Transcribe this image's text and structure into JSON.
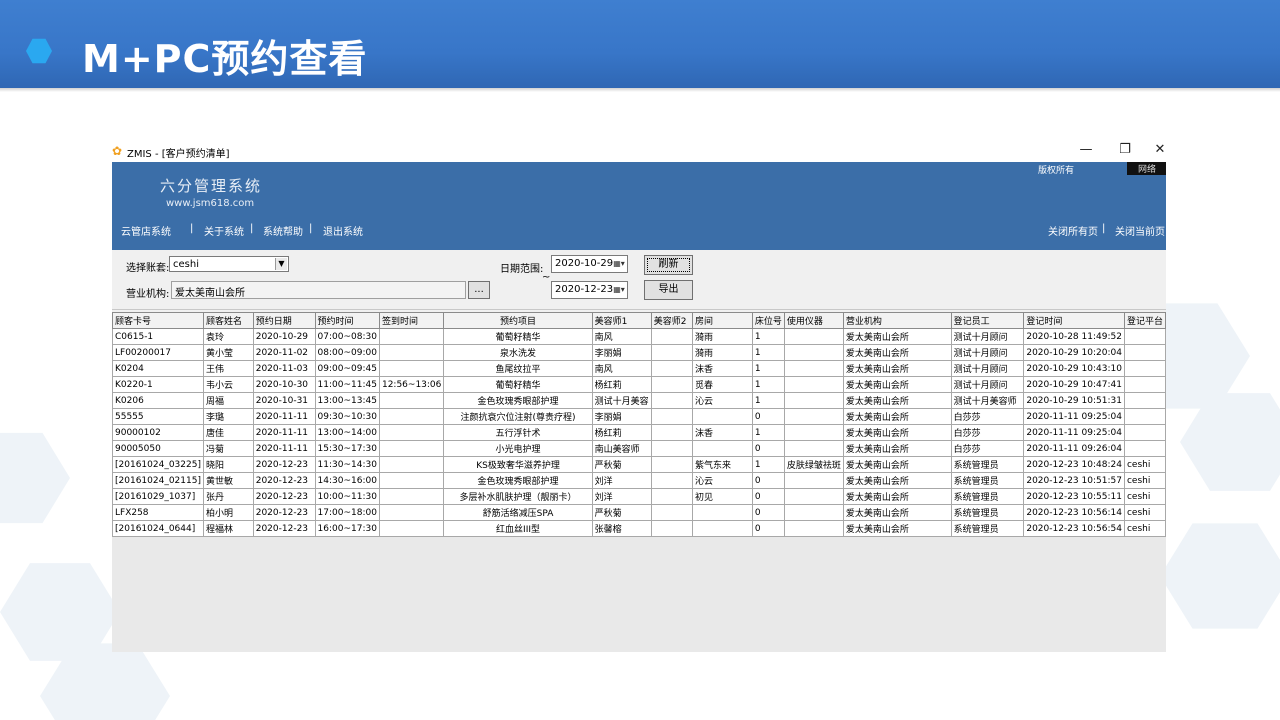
{
  "slide": {
    "title": "M+PC预约查看"
  },
  "window": {
    "title": "ZMIS - [客户预约清单]",
    "app_icon": "flower-icon",
    "minimize": "—",
    "restore": "❐",
    "close": "✕"
  },
  "banner": {
    "brand": "六分管理系统",
    "url": "www.jsm618.com",
    "copyright": "版权所有",
    "network": "网络",
    "menu": [
      "云管店系统",
      "关于系统",
      "系统帮助",
      "退出系统"
    ],
    "separator": "|",
    "right_menu": [
      "关闭所有页",
      "关闭当前页"
    ]
  },
  "filter": {
    "account_label": "选择账套:",
    "account_value": "ceshi",
    "org_label": "营业机构:",
    "org_value": "爱太美南山会所",
    "browse": "...",
    "date_label": "日期范围:",
    "date_tilde": "~",
    "date_from": "2020-10-29",
    "date_to": "2020-12-23",
    "refresh": "刷新",
    "export": "导出"
  },
  "table": {
    "columns": [
      "顾客卡号",
      "顾客姓名",
      "预约日期",
      "预约时间",
      "签到时间",
      "预约项目",
      "美容师1",
      "美容师2",
      "房间",
      "床位号",
      "使用仪器",
      "营业机构",
      "登记员工",
      "登记时间",
      "登记平台"
    ],
    "rows": [
      [
        "C0615-1",
        "袁玲",
        "2020-10-29",
        "07:00~08:30",
        "",
        "葡萄籽精华",
        "南风",
        "",
        "漪雨",
        "1",
        "",
        "爱太美南山会所",
        "测试十月顾问",
        "2020-10-28 11:49:52",
        ""
      ],
      [
        "LF00200017",
        "黄小莹",
        "2020-11-02",
        "08:00~09:00",
        "",
        "泉水洗发",
        "李丽娟",
        "",
        "漪雨",
        "1",
        "",
        "爱太美南山会所",
        "测试十月顾问",
        "2020-10-29 10:20:04",
        ""
      ],
      [
        "K0204",
        "王伟",
        "2020-11-03",
        "09:00~09:45",
        "",
        "鱼尾纹拉平",
        "南风",
        "",
        "沫香",
        "1",
        "",
        "爱太美南山会所",
        "测试十月顾问",
        "2020-10-29 10:43:10",
        ""
      ],
      [
        "K0220-1",
        "韦小云",
        "2020-10-30",
        "11:00~11:45",
        "12:56~13:06",
        "葡萄籽精华",
        "杨红莉",
        "",
        "觅春",
        "1",
        "",
        "爱太美南山会所",
        "测试十月顾问",
        "2020-10-29 10:47:41",
        ""
      ],
      [
        "K0206",
        "周福",
        "2020-10-31",
        "13:00~13:45",
        "",
        "金色玫瑰秀眼部护理",
        "测试十月美容",
        "",
        "沁云",
        "1",
        "",
        "爱太美南山会所",
        "测试十月美容师",
        "2020-10-29 10:51:31",
        ""
      ],
      [
        "55555",
        "李璐",
        "2020-11-11",
        "09:30~10:30",
        "",
        "注颜抗衰穴位注射(尊贵疗程)",
        "李丽娟",
        "",
        "",
        "0",
        "",
        "爱太美南山会所",
        "白莎莎",
        "2020-11-11 09:25:04",
        ""
      ],
      [
        "90000102",
        "唐佳",
        "2020-11-11",
        "13:00~14:00",
        "",
        "五行浮针术",
        "杨红莉",
        "",
        "沫香",
        "1",
        "",
        "爱太美南山会所",
        "白莎莎",
        "2020-11-11 09:25:04",
        ""
      ],
      [
        "90005050",
        "冯菊",
        "2020-11-11",
        "15:30~17:30",
        "",
        "小光电护理",
        "南山美容师",
        "",
        "",
        "0",
        "",
        "爱太美南山会所",
        "白莎莎",
        "2020-11-11 09:26:04",
        ""
      ],
      [
        "[20161024_03225]",
        "晓阳",
        "2020-12-23",
        "11:30~14:30",
        "",
        "KS极致奢华滋养护理",
        "严秋菊",
        "",
        "紫气东来",
        "1",
        "皮肤绿皱祛斑",
        "爱太美南山会所",
        "系统管理员",
        "2020-12-23 10:48:24",
        "ceshi"
      ],
      [
        "[20161024_02115]",
        "黄世敏",
        "2020-12-23",
        "14:30~16:00",
        "",
        "金色玫瑰秀眼部护理",
        "刘洋",
        "",
        "沁云",
        "0",
        "",
        "爱太美南山会所",
        "系统管理员",
        "2020-12-23 10:51:57",
        "ceshi"
      ],
      [
        "[20161029_1037]",
        "张丹",
        "2020-12-23",
        "10:00~11:30",
        "",
        "多层补水肌肤护理（靓丽卡）",
        "刘洋",
        "",
        "初见",
        "0",
        "",
        "爱太美南山会所",
        "系统管理员",
        "2020-12-23 10:55:11",
        "ceshi"
      ],
      [
        "LFX258",
        "柏小明",
        "2020-12-23",
        "17:00~18:00",
        "",
        "舒筋活络减压SPA",
        "严秋菊",
        "",
        "",
        "0",
        "",
        "爱太美南山会所",
        "系统管理员",
        "2020-12-23 10:56:14",
        "ceshi"
      ],
      [
        "[20161024_0644]",
        "程福林",
        "2020-12-23",
        "16:00~17:30",
        "",
        "红血丝III型",
        "张馨榕",
        "",
        "",
        "0",
        "",
        "爱太美南山会所",
        "系统管理员",
        "2020-12-23 10:56:54",
        "ceshi"
      ]
    ]
  }
}
